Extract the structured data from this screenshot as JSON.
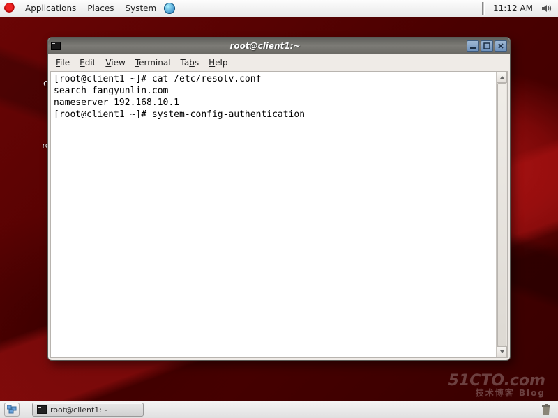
{
  "top_panel": {
    "menus": {
      "applications": "Applications",
      "places": "Places",
      "system": "System"
    },
    "clock": "11:12 AM"
  },
  "desktop": {
    "computer_label": "C",
    "home_label": "ro"
  },
  "window": {
    "title": "root@client1:~",
    "menus": {
      "file": {
        "u": "F",
        "rest": "ile"
      },
      "edit": {
        "u": "E",
        "rest": "dit"
      },
      "view": {
        "u": "V",
        "rest": "iew"
      },
      "terminal": {
        "u": "T",
        "rest": "erminal"
      },
      "tabs": {
        "pre": "Ta",
        "u": "b",
        "rest": "s"
      },
      "help": {
        "u": "H",
        "rest": "elp"
      }
    },
    "terminal_lines": [
      "[root@client1 ~]# cat /etc/resolv.conf",
      "search fangyunlin.com",
      "nameserver 192.168.10.1",
      "[root@client1 ~]# system-config-authentication"
    ]
  },
  "taskbar": {
    "task_label": "root@client1:~"
  },
  "watermark": {
    "main": "51CTO.com",
    "sub": "技术博客  Blog"
  }
}
